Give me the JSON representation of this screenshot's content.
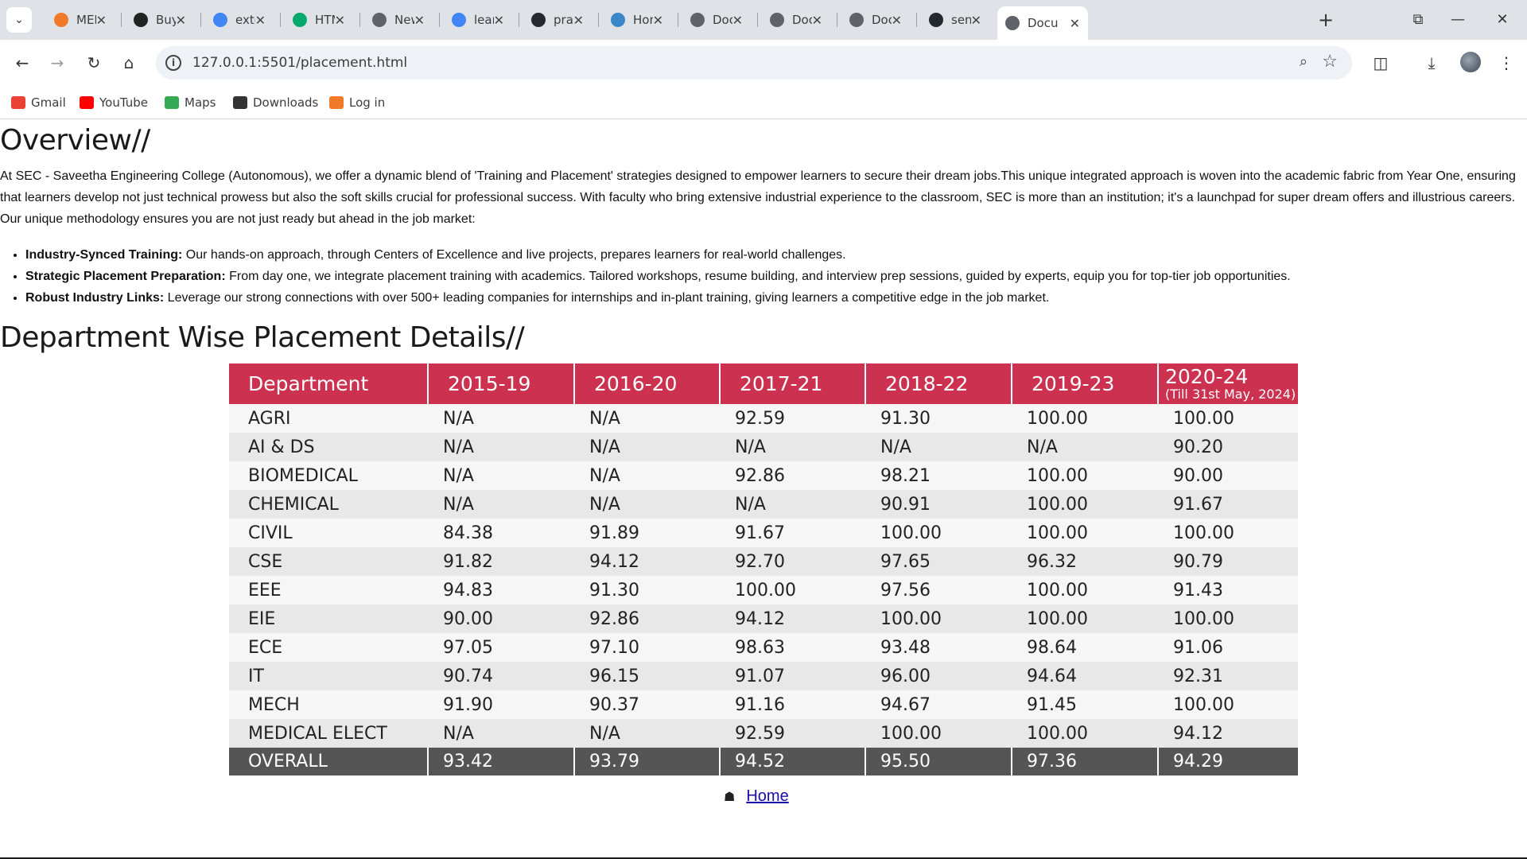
{
  "browser": {
    "tabs": [
      {
        "title": "MER",
        "icon": "meesho-icon",
        "color": "#f07a2a"
      },
      {
        "title": "Buy D",
        "icon": "amazon-icon",
        "color": "#222222"
      },
      {
        "title": "exter",
        "icon": "google-icon",
        "color": "#4285f4"
      },
      {
        "title": "HTM",
        "icon": "w3schools-icon",
        "color": "#04aa6d"
      },
      {
        "title": "New",
        "icon": "chrome-icon",
        "color": "#5f6368"
      },
      {
        "title": "learn",
        "icon": "google-icon",
        "color": "#4285f4"
      },
      {
        "title": "prad",
        "icon": "github-icon",
        "color": "#24292f"
      },
      {
        "title": "Hom",
        "icon": "home-page-icon",
        "color": "#3a86c8"
      },
      {
        "title": "Docu",
        "icon": "globe-icon",
        "color": "#5f6368"
      },
      {
        "title": "Docu",
        "icon": "globe-icon",
        "color": "#5f6368"
      },
      {
        "title": "Docu",
        "icon": "globe-icon",
        "color": "#5f6368"
      },
      {
        "title": "senth",
        "icon": "github-icon",
        "color": "#24292f"
      },
      {
        "title": "Docu",
        "icon": "globe-icon",
        "color": "#5f6368",
        "active": true
      }
    ],
    "url": "127.0.0.1:5501/placement.html",
    "bookmarks": [
      {
        "label": "Gmail",
        "icon": "gmail-icon",
        "color": "#ea4335"
      },
      {
        "label": "YouTube",
        "icon": "youtube-icon",
        "color": "#ff0000"
      },
      {
        "label": "Maps",
        "icon": "maps-icon",
        "color": "#34a853"
      },
      {
        "label": "Downloads",
        "icon": "download-icon",
        "color": "#333333"
      },
      {
        "label": "Log in",
        "icon": "login-icon",
        "color": "#f07a2a"
      }
    ]
  },
  "page": {
    "overview_heading": "Overview//",
    "intro": "At SEC - Saveetha Engineering College (Autonomous), we offer a dynamic blend of 'Training and Placement' strategies designed to empower learners to secure their dream jobs.This unique integrated approach is woven into the academic fabric from Year One, ensuring that learners develop not just technical prowess but also the soft skills crucial for professional success. With faculty who bring extensive industrial experience to the classroom, SEC is more than an institution; it's a launchpad for super dream offers and illustrious careers. Our unique methodology ensures you are not just ready but ahead in the job market:",
    "bullets": [
      {
        "title": "Industry-Synced Training:",
        "text": " Our hands-on approach, through Centers of Excellence and live projects, prepares learners for real-world challenges."
      },
      {
        "title": "Strategic Placement Preparation:",
        "text": " From day one, we integrate placement training with academics. Tailored workshops, resume building, and interview prep sessions, guided by experts, equip you for top-tier job opportunities."
      },
      {
        "title": "Robust Industry Links:",
        "text": " Leverage our strong connections with over 500+ leading companies for internships and in-plant training, giving learners a competitive edge in the job market."
      }
    ],
    "dept_heading": "Department Wise Placement Details//",
    "table": {
      "headers": [
        "Department",
        "2015-19",
        "2016-20",
        "2017-21",
        "2018-22",
        "2019-23",
        "2020-24"
      ],
      "last_header_note": "(Till 31st May, 2024)",
      "rows": [
        [
          "AGRI",
          "N/A",
          "N/A",
          "92.59",
          "91.30",
          "100.00",
          "100.00"
        ],
        [
          "AI & DS",
          "N/A",
          "N/A",
          "N/A",
          "N/A",
          "N/A",
          "90.20"
        ],
        [
          "BIOMEDICAL",
          "N/A",
          "N/A",
          "92.86",
          "98.21",
          "100.00",
          "90.00"
        ],
        [
          "CHEMICAL",
          "N/A",
          "N/A",
          "N/A",
          "90.91",
          "100.00",
          "91.67"
        ],
        [
          "CIVIL",
          "84.38",
          "91.89",
          "91.67",
          "100.00",
          "100.00",
          "100.00"
        ],
        [
          "CSE",
          "91.82",
          "94.12",
          "92.70",
          "97.65",
          "96.32",
          "90.79"
        ],
        [
          "EEE",
          "94.83",
          "91.30",
          "100.00",
          "97.56",
          "100.00",
          "91.43"
        ],
        [
          "EIE",
          "90.00",
          "92.86",
          "94.12",
          "100.00",
          "100.00",
          "100.00"
        ],
        [
          "ECE",
          "97.05",
          "97.10",
          "98.63",
          "93.48",
          "98.64",
          "91.06"
        ],
        [
          "IT",
          "90.74",
          "96.15",
          "91.07",
          "96.00",
          "94.64",
          "92.31"
        ],
        [
          "MECH",
          "91.90",
          "90.37",
          "91.16",
          "94.67",
          "91.45",
          "100.00"
        ],
        [
          "MEDICAL ELECT",
          "N/A",
          "N/A",
          "92.59",
          "100.00",
          "100.00",
          "94.12"
        ]
      ],
      "footer": [
        "OVERALL",
        "93.42",
        "93.79",
        "94.52",
        "95.50",
        "97.36",
        "94.29"
      ]
    },
    "home_link": "Home"
  },
  "colors": {
    "table_header": "#cc3150",
    "table_footer": "#555555",
    "link": "#1a0dab"
  }
}
